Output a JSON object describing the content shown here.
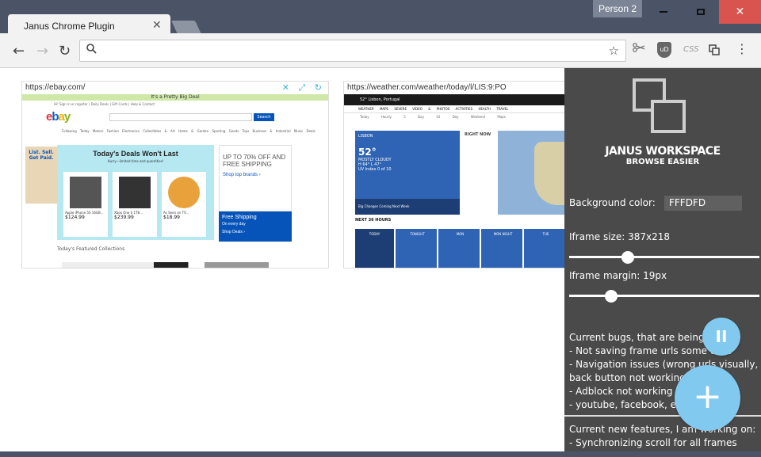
{
  "window": {
    "tab_title": "Janus Chrome Plugin",
    "tab_close": "✕",
    "person": "Person 2",
    "min": "",
    "max": "",
    "close": "✕"
  },
  "toolbar": {
    "back": "←",
    "forward": "→",
    "reload": "↻",
    "search_glyph": "⚲",
    "address_value": "",
    "star": "☆",
    "ext_css": "CSS",
    "ext_ub": "uD",
    "menu": "⋮"
  },
  "frames": [
    {
      "url": "https://ebay.com/",
      "tools": "✕ ⤢ ↻",
      "banner": "It's a Pretty Big Deal",
      "top_links": "Hi! Sign in or register  |  Daily Deals  |  Gift Cards  |  Help & Contact",
      "search_btn": "Search",
      "categories": "Following Today Motors Fashion Electronics Collectibles & Art Home & Garden Sporting Goods Toys Business & Industrial Music Deals",
      "side_ad": "List. Sell. Get Paid.",
      "deals_title": "Today's Deals Won't Last",
      "deals_sub": "Hurry—limited time and quantities!",
      "items": [
        {
          "name": "Apple iPhone 5S 16GB...",
          "price": "$124.99"
        },
        {
          "name": "Xbox One S 1TB...",
          "price": "$239.99"
        },
        {
          "name": "As Seen on TV...",
          "price": "$18.99"
        }
      ],
      "promo": "UP TO 70% OFF AND FREE SHIPPING",
      "promo_link": "Shop top brands ›",
      "ship_title": "Free Shipping",
      "ship_sub": "On every day",
      "ship_link": "Shop Deals ›",
      "featured": "Today's Featured Collections"
    },
    {
      "url": "https://weather.com/weather/today/l/LIS:9:PO",
      "header": "52° Lisbon, Portugal",
      "nav": "WEATHER MAPS SEVERE VIDEO & PHOTOS ACTIVITIES HEALTH TRAVEL",
      "sub": "Today Hourly 5 Day 10 Day Weekend Maps",
      "location": "LISBON",
      "temp": "52°",
      "condition": "MOSTLY CLOUDY",
      "hilo": "H 64° L 47°",
      "uv": "UV Index 0 of 10",
      "bar_text": "Big Changes Coming Next Week",
      "right_now": "RIGHT NOW",
      "next_hours": "NEXT 36 HOURS",
      "tiles": [
        "TODAY",
        "TONIGHT",
        "MON",
        "MON NIGHT",
        "TUE"
      ]
    }
  ],
  "sidebar": {
    "title": "JANUS WORKSPACE",
    "subtitle": "BROWSE EASIER",
    "bg_label": "Background color:",
    "bg_value": "FFFDFD",
    "size_label": "Iframe size: 387x218",
    "size_slider": 0.33,
    "margin_label": "Iframe margin: 19px",
    "margin_slider": 0.24,
    "bugs": [
      "Current bugs, that are being fixed",
      "- Not saving frame urls some time",
      "- Navigation issues (wrong urls visually,",
      "back button not working",
      "- Adblock not working in",
      "- youtube, facebook, etc"
    ],
    "features": [
      "Current new features, I am working on:",
      "- Synchronizing scroll for all frames"
    ]
  },
  "fab": {
    "pause": "II",
    "add": "+"
  },
  "colors": {
    "accent": "#82c9f0",
    "sidebar": "#4a4a4a",
    "frame_chrome": "#4a5466"
  }
}
